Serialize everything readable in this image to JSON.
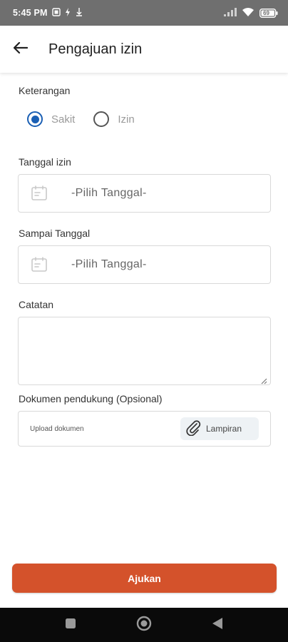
{
  "status_bar": {
    "time": "5:45 PM",
    "battery": "69"
  },
  "app_bar": {
    "title": "Pengajuan izin"
  },
  "form": {
    "keterangan_label": "Keterangan",
    "options": [
      {
        "label": "Sakit",
        "selected": true
      },
      {
        "label": "Izin",
        "selected": false
      }
    ],
    "tanggal_izin_label": "Tanggal izin",
    "tanggal_izin_value": "-Pilih Tanggal-",
    "sampai_tanggal_label": "Sampai Tanggal",
    "sampai_tanggal_value": "-Pilih Tanggal-",
    "catatan_label": "Catatan",
    "catatan_value": "",
    "dokumen_label": "Dokumen pendukung (Opsional)",
    "upload_hint": "Upload dokumen",
    "attach_label": "Lampiran"
  },
  "submit_label": "Ajukan",
  "colors": {
    "accent": "#d4522b",
    "radio": "#1a5fb4",
    "status_bar": "#6f6f6f"
  }
}
